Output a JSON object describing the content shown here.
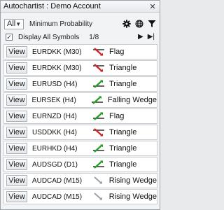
{
  "window": {
    "title": "Autochartist : Demo Account",
    "close": "✕"
  },
  "filters": {
    "select_value": "All",
    "min_prob_label": "Minimum Probability"
  },
  "options": {
    "display_all_label": "Display All Symbols",
    "page": "1/8",
    "checked": "✓"
  },
  "view_label": "View",
  "rows": [
    {
      "symbol": "EURDKK (M30)",
      "pattern": "Flag",
      "trend": "down"
    },
    {
      "symbol": "EURDKK (M30)",
      "pattern": "Triangle",
      "trend": "down"
    },
    {
      "symbol": "EURUSD (H4)",
      "pattern": "Triangle",
      "trend": "up"
    },
    {
      "symbol": "EURSEK (H4)",
      "pattern": "Falling Wedge",
      "trend": "up"
    },
    {
      "symbol": "EURNZD (H4)",
      "pattern": "Flag",
      "trend": "up"
    },
    {
      "symbol": "USDDKK (H4)",
      "pattern": "Triangle",
      "trend": "down"
    },
    {
      "symbol": "EURHKD (H4)",
      "pattern": "Triangle",
      "trend": "up"
    },
    {
      "symbol": "AUDSGD (D1)",
      "pattern": "Triangle",
      "trend": "up"
    },
    {
      "symbol": "AUDCAD (M15)",
      "pattern": "Rising Wedge",
      "trend": "neutral"
    },
    {
      "symbol": "AUDCAD (M15)",
      "pattern": "Rising Wedge",
      "trend": "neutral"
    }
  ],
  "colors": {
    "up": "#22a022",
    "down": "#d42020",
    "neutral": "#9aa2aa"
  }
}
